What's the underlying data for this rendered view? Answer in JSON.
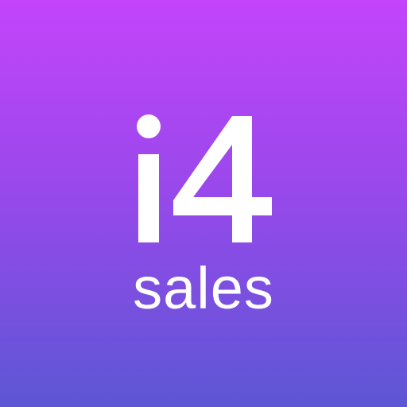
{
  "app_icon": {
    "logo_text": "i4",
    "word": "sales",
    "colors": {
      "gradient_top": "#c444fb",
      "gradient_mid": "#9a48ec",
      "gradient_bottom": "#5c57d4",
      "foreground": "#ffffff"
    }
  }
}
